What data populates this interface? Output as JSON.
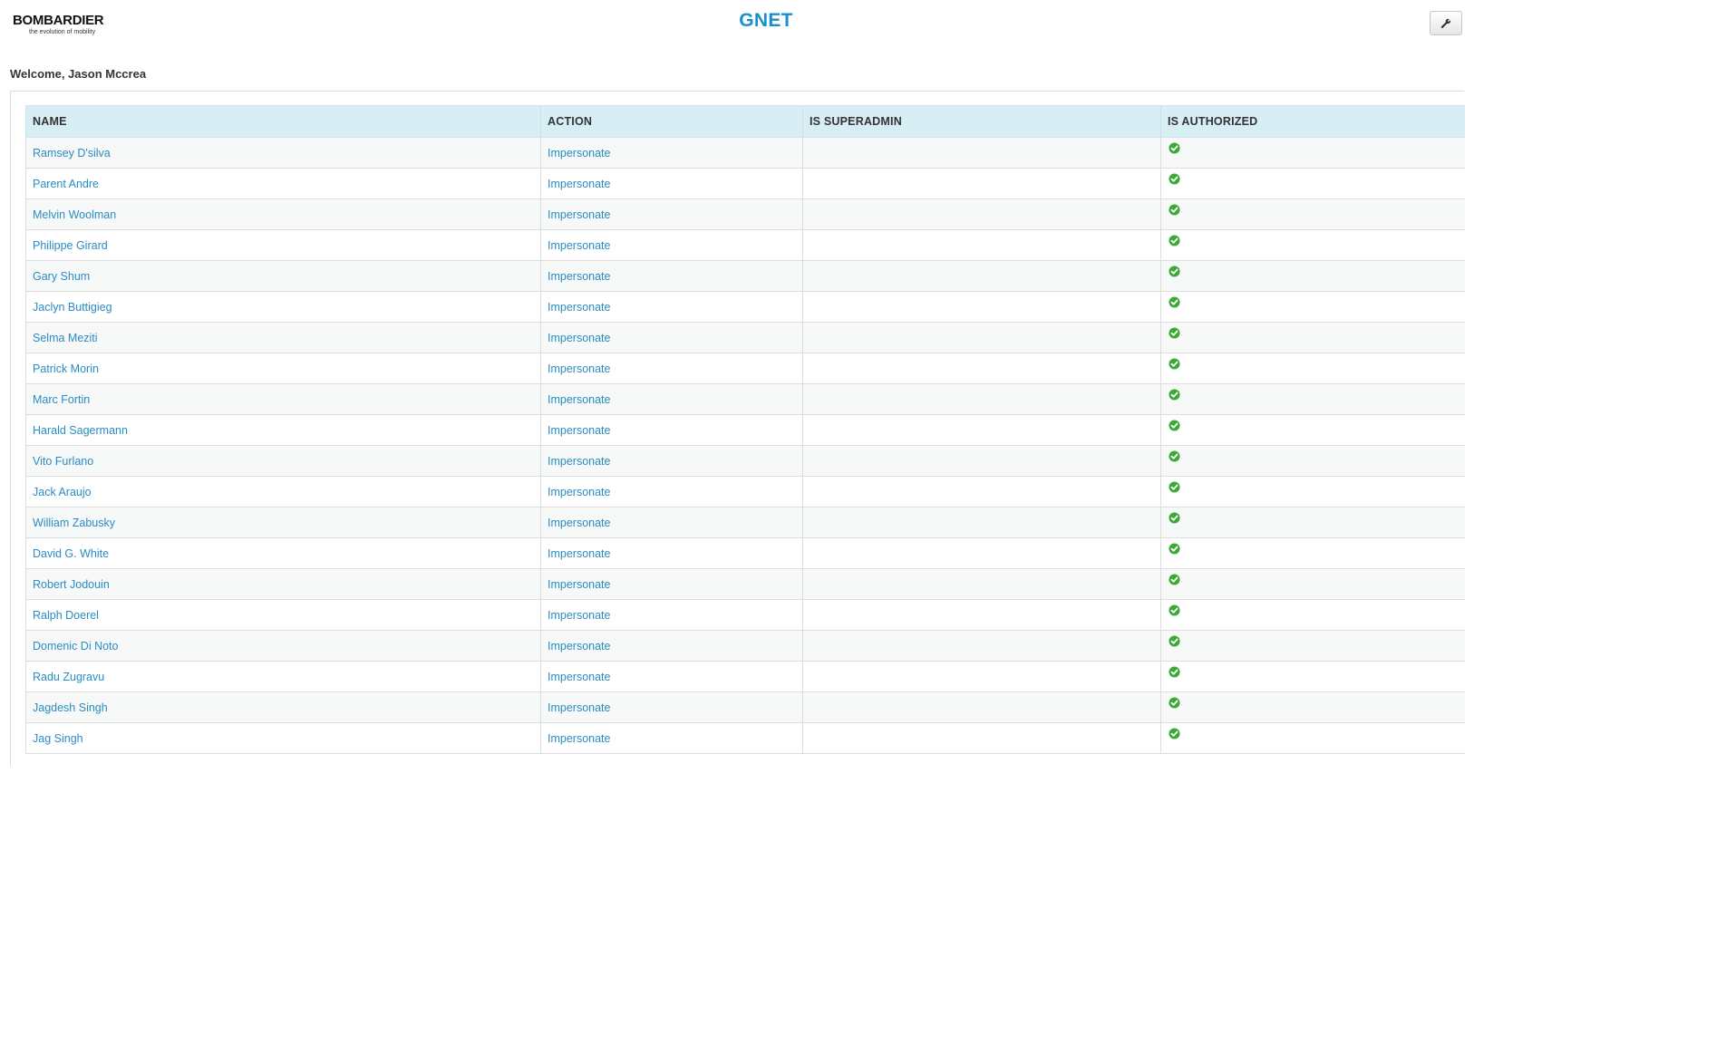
{
  "header": {
    "logo_text": "BOMBARDIER",
    "logo_tagline": "the evolution of mobility",
    "app_title": "GNET",
    "tool_button_icon": "wrench-icon"
  },
  "welcome_text": "Welcome, Jason Mccrea",
  "table": {
    "columns": [
      "NAME",
      "ACTION",
      "IS SUPERADMIN",
      "IS AUTHORIZED"
    ],
    "rows": [
      {
        "name": "Ramsey D'silva",
        "action": "Impersonate",
        "is_superadmin": "",
        "is_authorized": true
      },
      {
        "name": "Parent Andre",
        "action": "Impersonate",
        "is_superadmin": "",
        "is_authorized": true
      },
      {
        "name": "Melvin Woolman",
        "action": "Impersonate",
        "is_superadmin": "",
        "is_authorized": true
      },
      {
        "name": "Philippe Girard",
        "action": "Impersonate",
        "is_superadmin": "",
        "is_authorized": true
      },
      {
        "name": "Gary Shum",
        "action": "Impersonate",
        "is_superadmin": "",
        "is_authorized": true
      },
      {
        "name": "Jaclyn Buttigieg",
        "action": "Impersonate",
        "is_superadmin": "",
        "is_authorized": true
      },
      {
        "name": "Selma Meziti",
        "action": "Impersonate",
        "is_superadmin": "",
        "is_authorized": true
      },
      {
        "name": "Patrick Morin",
        "action": "Impersonate",
        "is_superadmin": "",
        "is_authorized": true
      },
      {
        "name": "Marc Fortin",
        "action": "Impersonate",
        "is_superadmin": "",
        "is_authorized": true
      },
      {
        "name": "Harald Sagermann",
        "action": "Impersonate",
        "is_superadmin": "",
        "is_authorized": true
      },
      {
        "name": "Vito Furlano",
        "action": "Impersonate",
        "is_superadmin": "",
        "is_authorized": true
      },
      {
        "name": "Jack Araujo",
        "action": "Impersonate",
        "is_superadmin": "",
        "is_authorized": true
      },
      {
        "name": "William Zabusky",
        "action": "Impersonate",
        "is_superadmin": "",
        "is_authorized": true
      },
      {
        "name": "David G. White",
        "action": "Impersonate",
        "is_superadmin": "",
        "is_authorized": true
      },
      {
        "name": "Robert Jodouin",
        "action": "Impersonate",
        "is_superadmin": "",
        "is_authorized": true
      },
      {
        "name": "Ralph Doerel",
        "action": "Impersonate",
        "is_superadmin": "",
        "is_authorized": true
      },
      {
        "name": "Domenic Di Noto",
        "action": "Impersonate",
        "is_superadmin": "",
        "is_authorized": true
      },
      {
        "name": "Radu Zugravu",
        "action": "Impersonate",
        "is_superadmin": "",
        "is_authorized": true
      },
      {
        "name": "Jagdesh Singh",
        "action": "Impersonate",
        "is_superadmin": "",
        "is_authorized": true
      },
      {
        "name": "Jag Singh",
        "action": "Impersonate",
        "is_superadmin": "",
        "is_authorized": true
      }
    ]
  },
  "colors": {
    "accent": "#1a8fcf",
    "link": "#2a8cc4",
    "header_bg": "#d8eef5",
    "authorized_check": "#3aa935"
  }
}
